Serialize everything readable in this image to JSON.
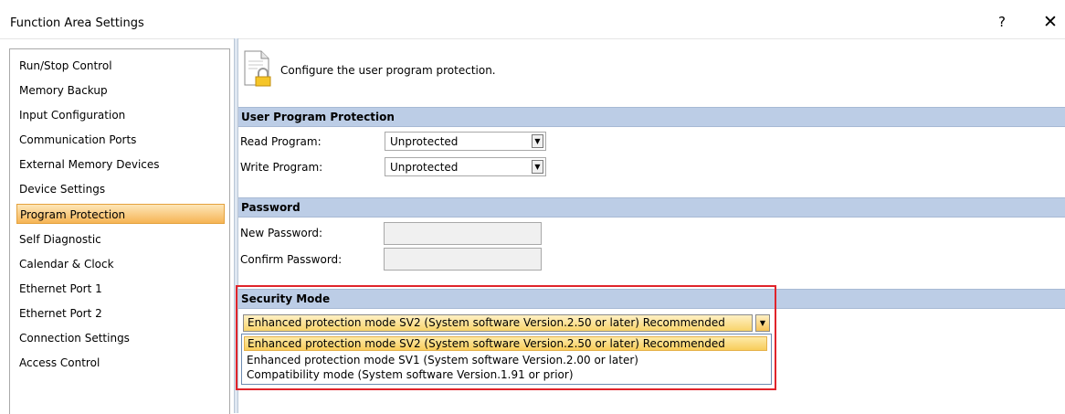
{
  "window": {
    "title": "Function Area Settings",
    "help_label": "?",
    "close_label": "✕"
  },
  "sidebar": {
    "items": [
      {
        "label": "Run/Stop Control"
      },
      {
        "label": "Memory Backup"
      },
      {
        "label": "Input Configuration"
      },
      {
        "label": "Communication Ports"
      },
      {
        "label": "External Memory Devices"
      },
      {
        "label": "Device Settings"
      },
      {
        "label": "Program Protection",
        "selected": true
      },
      {
        "label": "Self Diagnostic"
      },
      {
        "label": "Calendar & Clock"
      },
      {
        "label": "Ethernet Port 1"
      },
      {
        "label": "Ethernet Port 2"
      },
      {
        "label": "Connection Settings"
      },
      {
        "label": "Access Control"
      }
    ]
  },
  "main": {
    "intro_text": "Configure the user program protection.",
    "protection": {
      "header": "User Program Protection",
      "read_label": "Read Program:",
      "read_value": "Unprotected",
      "write_label": "Write Program:",
      "write_value": "Unprotected"
    },
    "password": {
      "header": "Password",
      "new_label": "New Password:",
      "new_value": "",
      "confirm_label": "Confirm Password:",
      "confirm_value": ""
    },
    "security": {
      "header": "Security Mode",
      "selected_value": "Enhanced protection mode SV2 (System software Version.2.50 or later) Recommended",
      "options": [
        "Enhanced protection mode SV2 (System software Version.2.50 or later) Recommended",
        "Enhanced protection mode SV1 (System software Version.2.00 or later)",
        "Compatibility mode (System software Version.1.91 or prior)"
      ]
    }
  },
  "icons": {
    "lock": "document-lock-icon",
    "dropdown": "chevron-down-icon"
  },
  "colors": {
    "selection": "#f6b455",
    "section_header": "#bccde6",
    "highlight_border": "#e0242b"
  }
}
